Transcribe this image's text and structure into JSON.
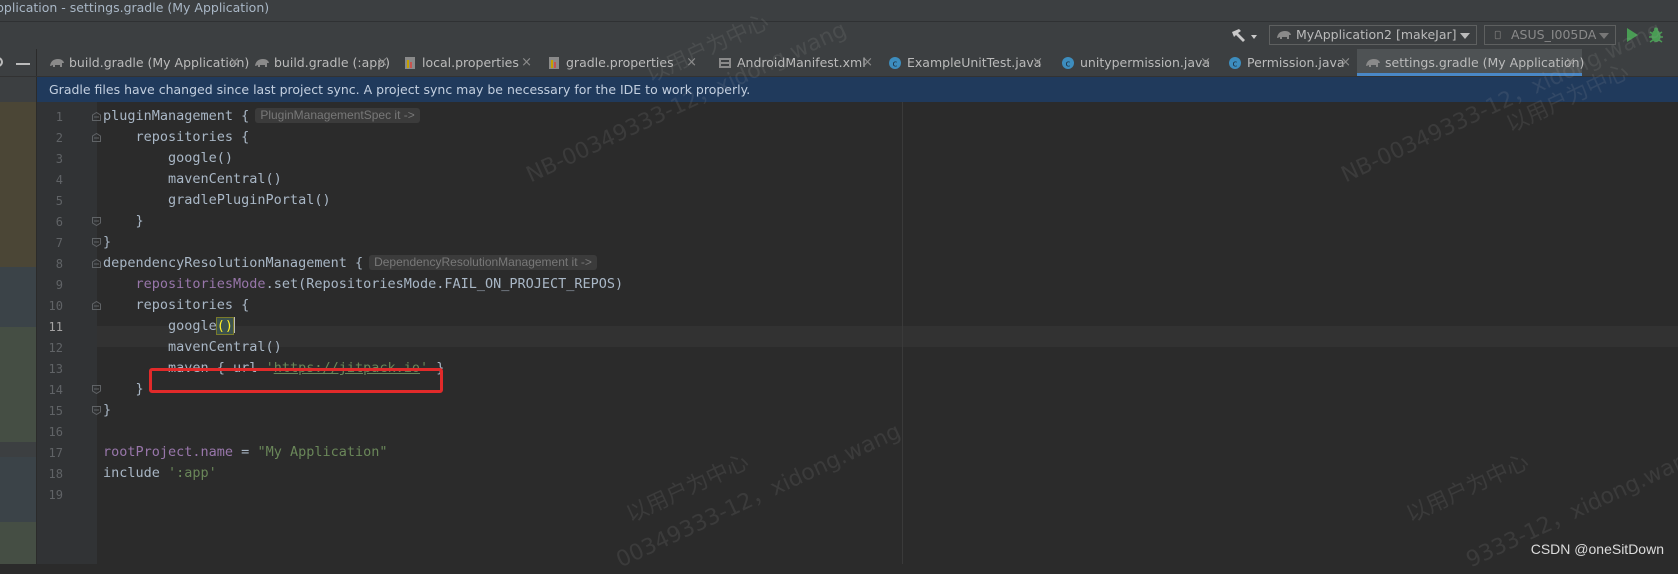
{
  "window": {
    "title": "pplication - settings.gradle (My Application)"
  },
  "toolbar": {
    "hammer_icon": "hammer-icon",
    "run_config": "MyApplication2 [makeJar]",
    "device": "ASUS_I005DA",
    "run_icon": "run-icon",
    "debug_icon": "debug-icon"
  },
  "tabs": [
    {
      "label": "build.gradle (My Application)",
      "icon": "gradle-elephant-icon",
      "active": false
    },
    {
      "label": "build.gradle (:app)",
      "icon": "gradle-elephant-icon",
      "active": false
    },
    {
      "label": "local.properties",
      "icon": "properties-icon",
      "active": false
    },
    {
      "label": "gradle.properties",
      "icon": "properties-icon",
      "active": false
    },
    {
      "label": "AndroidManifest.xml",
      "icon": "manifest-icon",
      "active": false
    },
    {
      "label": "ExampleUnitTest.java",
      "icon": "java-class-icon",
      "active": false
    },
    {
      "label": "unitypermission.java",
      "icon": "java-class-icon",
      "active": false
    },
    {
      "label": "Permission.java",
      "icon": "java-class-icon",
      "active": false
    },
    {
      "label": "settings.gradle (My Application)",
      "icon": "gradle-elephant-icon",
      "active": true
    }
  ],
  "tab_close": "×",
  "notification": "Gradle files have changed since last project sync. A project sync may be necessary for the IDE to work properly.",
  "editor": {
    "current_line": 11,
    "line_numbers": [
      "1",
      "2",
      "3",
      "4",
      "5",
      "6",
      "7",
      "8",
      "9",
      "10",
      "11",
      "12",
      "13",
      "14",
      "15",
      "16",
      "17",
      "18",
      "19"
    ],
    "lines": {
      "l1": "pluginManagement {",
      "l1_hint": "PluginManagementSpec it ->",
      "l2": "    repositories {",
      "l3": "        google()",
      "l4": "        mavenCentral()",
      "l5": "        gradlePluginPortal()",
      "l6": "    }",
      "l7": "}",
      "l8": "dependencyResolutionManagement {",
      "l8_hint": "DependencyResolutionManagement it ->",
      "l9_prefix": "    ",
      "l9_prop": "repositoriesMode",
      "l9_rest": ".set(RepositoriesMode.FAIL_ON_PROJECT_REPOS)",
      "l10": "    repositories {",
      "l11_prefix": "        google",
      "l11_paren": "()",
      "l12": "        mavenCentral()",
      "l13_prefix": "        maven { url ",
      "l13_q1": "'",
      "l13_url": "https://jitpack.io",
      "l13_q2": "'",
      "l13_suffix": " }",
      "l14": "    }",
      "l15": "}",
      "l16": "",
      "l17_prop": "rootProject.name",
      "l17_eq": " = ",
      "l17_str": "\"My Application\"",
      "l18_prefix": "include ",
      "l18_str": "':app'",
      "l19": ""
    }
  },
  "watermarks": [
    "以用户为中心",
    "NB-00349333-12，xidong.wang",
    "以用户为中心",
    "NB-00349333-12，xidong.wang",
    "以用户为中心",
    "00349333-12，xidong.wang",
    "以用户为中心",
    "9333-12，xidong.wang"
  ],
  "csdn_label": "CSDN @oneSitDown",
  "colors": {
    "keyword_purple": "#9876aa",
    "string_green": "#6a8759",
    "notification_bg": "#203a5c",
    "annotation_red": "#e12a2a",
    "active_tab_underline": "#4a88c7",
    "run_green": "#499c54"
  }
}
